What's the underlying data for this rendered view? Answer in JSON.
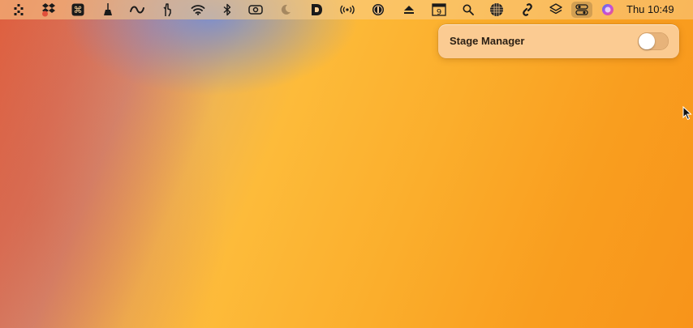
{
  "menubar": {
    "icons": [
      "dots-grid-icon",
      "dropbox-icon",
      "command-key-icon",
      "broom-icon",
      "infinity-icon",
      "hand-gesture-icon",
      "wifi-icon",
      "bluetooth-icon",
      "camera-icon",
      "moon-icon",
      "d-app-icon",
      "broadcast-icon",
      "one-password-icon",
      "eject-icon",
      "calendar-icon",
      "search-icon",
      "globe-grid-icon",
      "chain-link-icon",
      "layers-icon",
      "control-center-icon",
      "siri-icon"
    ],
    "calendar_day": "9",
    "clock": "Thu 10:49"
  },
  "popover": {
    "label": "Stage Manager",
    "enabled": false
  },
  "colors": {
    "popover_bg": "#fbcb92",
    "wallpaper_orange": "#f99e1f",
    "wallpaper_red": "#e0603f",
    "wallpaper_blue": "#6e8cdc"
  }
}
